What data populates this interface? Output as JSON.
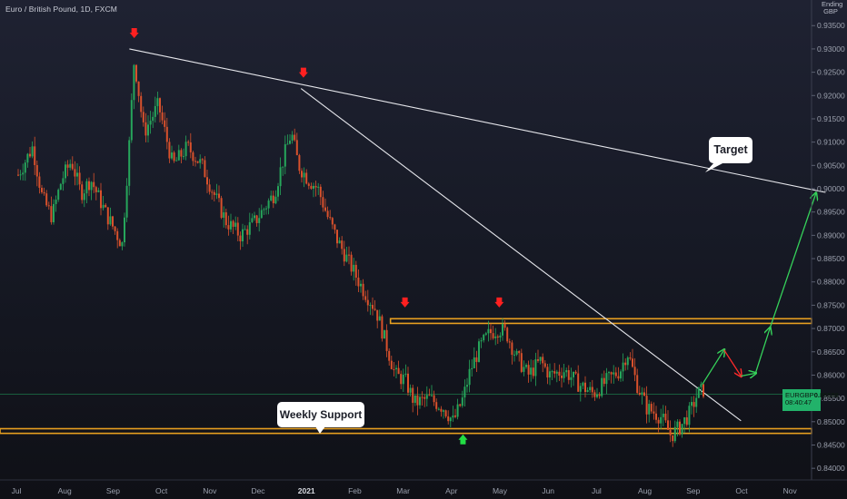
{
  "header": {
    "title": "Euro / British Pound, 1D, FXCM",
    "currency_top": "Ending",
    "currency_bottom": "GBP"
  },
  "price_badge": {
    "symbol": "EURGBP",
    "price": "0.85588",
    "countdown": "08:40:47"
  },
  "callouts": {
    "target": "Target",
    "weekly_support": "Weekly Support"
  },
  "colors": {
    "up_candle": "#26a65b",
    "down_candle": "#d9512c",
    "support_zone": "#e8a020",
    "trendline": "#e6e7ec",
    "signal_down_arrow": "#ff2020",
    "signal_up_arrow": "#22dd44",
    "projection_up": "#35d25a",
    "projection_down": "#ff2a2a",
    "price_line": "#1f8f55",
    "badge": "#22b26a"
  },
  "chart_data": {
    "type": "candlestick",
    "symbol": "EURGBP",
    "timeframe": "1D",
    "x_tick_labels": [
      "Jul",
      "Aug",
      "Sep",
      "Oct",
      "Nov",
      "Dec",
      "2021",
      "Feb",
      "Mar",
      "Apr",
      "May",
      "Jun",
      "Jul",
      "Aug",
      "Sep",
      "Oct",
      "Nov"
    ],
    "y_tick_labels": [
      "0.84000",
      "0.84500",
      "0.85000",
      "0.85500",
      "0.86000",
      "0.86500",
      "0.87000",
      "0.87500",
      "0.88000",
      "0.88500",
      "0.89000",
      "0.89500",
      "0.90000",
      "0.90500",
      "0.91000",
      "0.91500",
      "0.92000",
      "0.92500",
      "0.93000",
      "0.93500"
    ],
    "ylim": [
      0.8375,
      0.9405
    ],
    "xlim": [
      0,
      16.7
    ],
    "last_price": 0.85588,
    "series_path": [
      [
        0.0,
        0.903
      ],
      [
        0.3,
        0.909
      ],
      [
        0.5,
        0.898
      ],
      [
        0.7,
        0.894
      ],
      [
        0.9,
        0.902
      ],
      [
        1.1,
        0.906
      ],
      [
        1.3,
        0.899
      ],
      [
        1.5,
        0.902
      ],
      [
        1.8,
        0.895
      ],
      [
        2.0,
        0.891
      ],
      [
        2.15,
        0.888
      ],
      [
        2.3,
        0.91
      ],
      [
        2.4,
        0.928
      ],
      [
        2.6,
        0.912
      ],
      [
        2.9,
        0.918
      ],
      [
        3.2,
        0.905
      ],
      [
        3.5,
        0.909
      ],
      [
        3.8,
        0.905
      ],
      [
        4.0,
        0.9
      ],
      [
        4.3,
        0.893
      ],
      [
        4.6,
        0.89
      ],
      [
        4.9,
        0.893
      ],
      [
        5.1,
        0.896
      ],
      [
        5.3,
        0.899
      ],
      [
        5.5,
        0.907
      ],
      [
        5.65,
        0.912
      ],
      [
        5.8,
        0.905
      ],
      [
        6.0,
        0.902
      ],
      [
        6.2,
        0.9
      ],
      [
        6.4,
        0.894
      ],
      [
        6.6,
        0.889
      ],
      [
        6.8,
        0.885
      ],
      [
        7.1,
        0.879
      ],
      [
        7.4,
        0.874
      ],
      [
        7.6,
        0.867
      ],
      [
        7.8,
        0.86
      ],
      [
        8.0,
        0.859
      ],
      [
        8.2,
        0.854
      ],
      [
        8.5,
        0.855
      ],
      [
        8.8,
        0.853
      ],
      [
        9.0,
        0.85
      ],
      [
        9.2,
        0.855
      ],
      [
        9.35,
        0.861
      ],
      [
        9.55,
        0.866
      ],
      [
        9.75,
        0.869
      ],
      [
        9.95,
        0.87
      ],
      [
        10.1,
        0.869
      ],
      [
        10.3,
        0.864
      ],
      [
        10.55,
        0.86
      ],
      [
        10.8,
        0.863
      ],
      [
        11.0,
        0.86
      ],
      [
        11.3,
        0.861
      ],
      [
        11.6,
        0.858
      ],
      [
        11.9,
        0.856
      ],
      [
        12.2,
        0.859
      ],
      [
        12.45,
        0.861
      ],
      [
        12.6,
        0.865
      ],
      [
        12.8,
        0.858
      ],
      [
        13.0,
        0.853
      ],
      [
        13.3,
        0.851
      ],
      [
        13.5,
        0.847
      ],
      [
        13.7,
        0.849
      ],
      [
        13.9,
        0.852
      ],
      [
        14.05,
        0.856
      ],
      [
        14.2,
        0.857
      ]
    ],
    "resistance_zone": [
      0.8711,
      0.8721
    ],
    "support_zone": [
      0.8475,
      0.8485
    ],
    "trendlines": [
      {
        "name": "long-term-trendline",
        "from": [
          2.3,
          0.93
        ],
        "to": [
          16.7,
          0.8992
        ]
      },
      {
        "name": "short-term-trendline",
        "from": [
          5.85,
          0.9215
        ],
        "to": [
          14.95,
          0.8502
        ]
      }
    ],
    "projection_path": [
      [
        14.15,
        0.858
      ],
      [
        14.6,
        0.8654
      ],
      [
        14.95,
        0.8598
      ],
      [
        15.25,
        0.8604
      ],
      [
        15.55,
        0.8701
      ],
      [
        16.5,
        0.899
      ]
    ],
    "signal_markers": [
      {
        "type": "down",
        "x": 2.4,
        "y": 0.9333
      },
      {
        "type": "down",
        "x": 5.9,
        "y": 0.9248
      },
      {
        "type": "down",
        "x": 8.0,
        "y": 0.8755
      },
      {
        "type": "down",
        "x": 9.95,
        "y": 0.8755
      },
      {
        "type": "up",
        "x": 9.2,
        "y": 0.8463
      }
    ]
  }
}
